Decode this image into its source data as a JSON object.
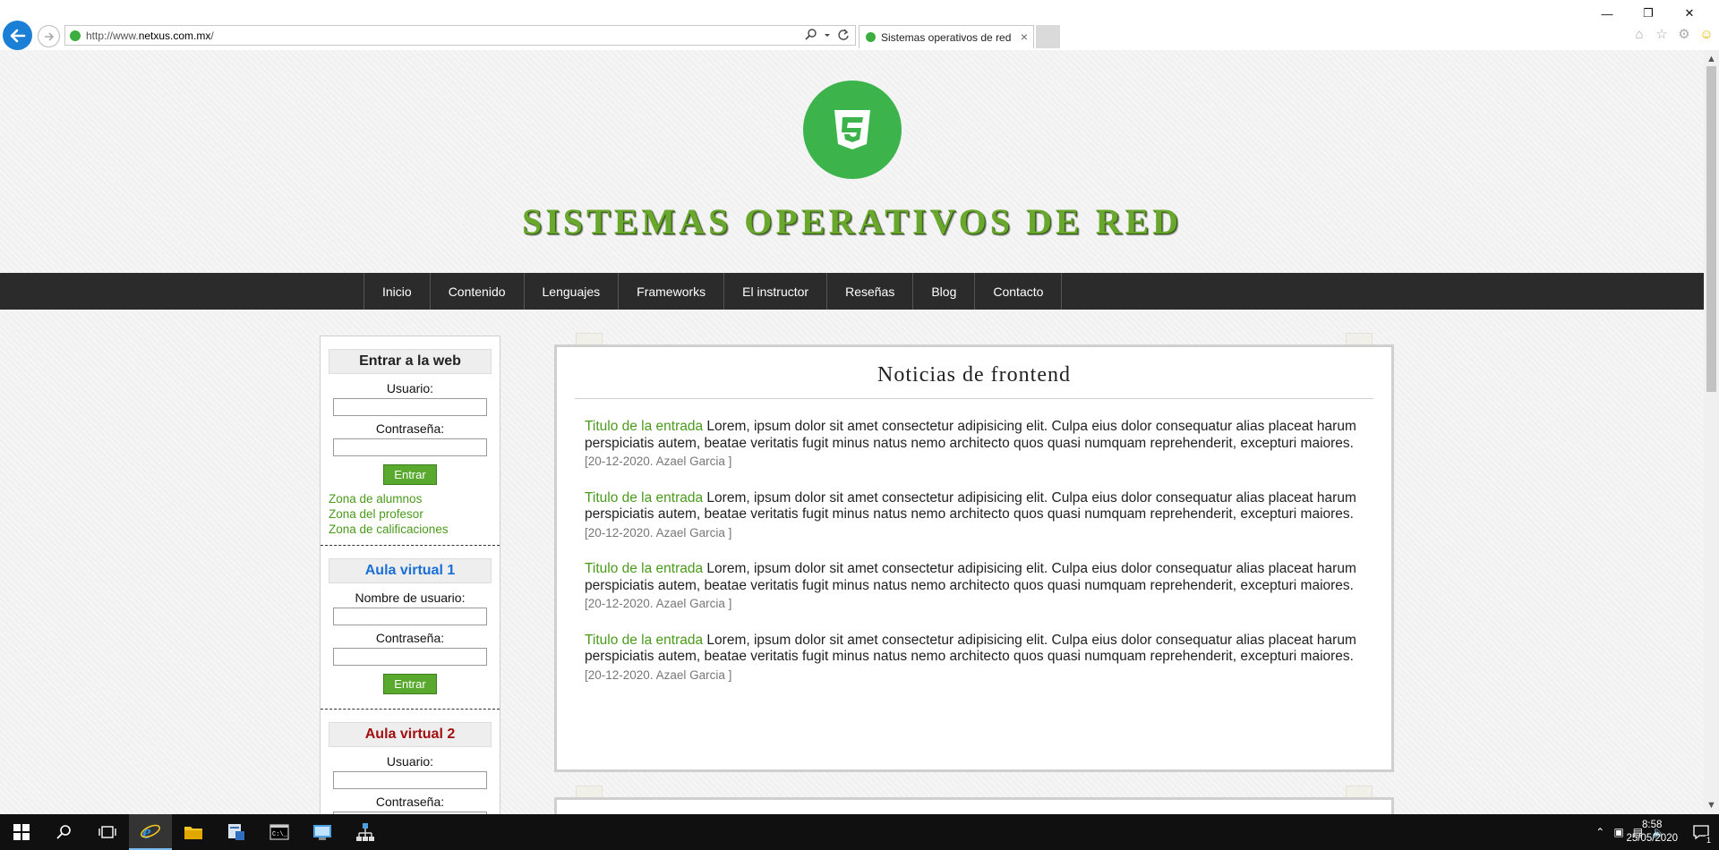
{
  "browser": {
    "url_prefix": "http://www.",
    "url_domain": "netxus.com.mx",
    "url_suffix": "/",
    "tab_title": "Sistemas operativos de red"
  },
  "site": {
    "title": "SISTEMAS OPERATIVOS DE RED",
    "nav": [
      "Inicio",
      "Contenido",
      "Lenguajes",
      "Frameworks",
      "El instructor",
      "Reseñas",
      "Blog",
      "Contacto"
    ]
  },
  "sidebar": {
    "login": {
      "heading": "Entrar a la web",
      "user_label": "Usuario:",
      "pass_label": "Contraseña:",
      "button": "Entrar",
      "links": [
        "Zona de alumnos",
        "Zona del profesor",
        "Zona de calificaciones"
      ]
    },
    "aula1": {
      "heading": "Aula virtual 1",
      "user_label": "Nombre de usuario:",
      "pass_label": "Contraseña:",
      "button": "Entrar",
      "heading_color": "#1a6fd6"
    },
    "aula2": {
      "heading": "Aula virtual 2",
      "user_label": "Usuario:",
      "pass_label": "Contraseña:",
      "heading_color": "#a01010"
    }
  },
  "main": {
    "panel_title": "Noticias de frontend",
    "entries": [
      {
        "title": "Titulo de la entrada",
        "text": " Lorem, ipsum dolor sit amet consectetur adipisicing elit. Culpa eius dolor consequatur alias placeat harum perspiciatis autem, beatae veritatis fugit minus natus nemo architecto quos quasi numquam reprehenderit, excepturi maiores.",
        "meta": "[20-12-2020. Azael Garcia ]"
      },
      {
        "title": "Titulo de la entrada",
        "text": " Lorem, ipsum dolor sit amet consectetur adipisicing elit. Culpa eius dolor consequatur alias placeat harum perspiciatis autem, beatae veritatis fugit minus natus nemo architecto quos quasi numquam reprehenderit, excepturi maiores.",
        "meta": "[20-12-2020. Azael Garcia ]"
      },
      {
        "title": "Titulo de la entrada",
        "text": " Lorem, ipsum dolor sit amet consectetur adipisicing elit. Culpa eius dolor consequatur alias placeat harum perspiciatis autem, beatae veritatis fugit minus natus nemo architecto quos quasi numquam reprehenderit, excepturi maiores.",
        "meta": "[20-12-2020. Azael Garcia ]"
      },
      {
        "title": "Titulo de la entrada",
        "text": " Lorem, ipsum dolor sit amet consectetur adipisicing elit. Culpa eius dolor consequatur alias placeat harum perspiciatis autem, beatae veritatis fugit minus natus nemo architecto quos quasi numquam reprehenderit, excepturi maiores.",
        "meta": "[20-12-2020. Azael Garcia ]"
      }
    ]
  },
  "taskbar": {
    "time": "8:58",
    "date": "25/05/2020",
    "notification_count": "1"
  },
  "colors": {
    "brand_green": "#3cb44b",
    "link_green": "#4a9a1b",
    "navbar": "#2b2b2b"
  }
}
